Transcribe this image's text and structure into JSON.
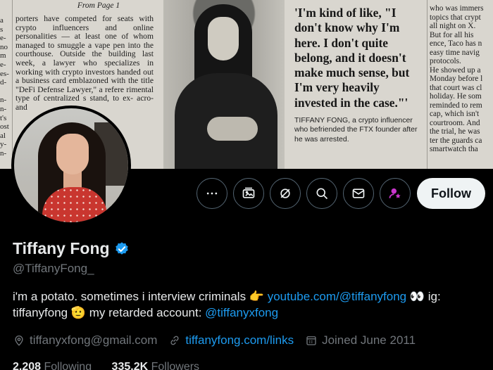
{
  "banner": {
    "left_edge_text": [
      "a",
      "s",
      "e-",
      "no",
      "m",
      "e-",
      "es-",
      "d-",
      "",
      "n-",
      "n-",
      "t's",
      "ost",
      "al",
      "y-",
      "n-"
    ],
    "kicker": "From Page 1",
    "article_text": "porters have competed for seats with crypto influencers and online personalities — at least one of whom managed to smuggle a vape pen into the courthouse. Outside the building last week, a lawyer who specializes in working with crypto investors handed out a business card emblazoned with the title \"DeFi Defense Lawyer,\" a refere rimental type of centralized s stand, to ex- acro- and",
    "quote": "'I'm kind of like, \"I don't know why I'm here. I don't quite belong, and it doesn't make much sense, but I'm very heavily invested in the case.\"'",
    "caption": "TIFFANY FONG, a crypto influencer who befriended the FTX founder after he was arrested.",
    "right_text": [
      "who was immers",
      "topics that crypt",
      "all night on X.",
      "But for all his",
      "ence, Taco has n",
      "easy time navig",
      "protocols.",
      "He showed up a",
      "Monday before l",
      "that court was cl",
      "holiday. He som",
      "reminded to rem",
      "cap, which isn't",
      "courtroom. And",
      "the trial, he was",
      "ter the guards ca",
      "smartwatch tha"
    ]
  },
  "actions": {
    "more_icon": "more-horizontal-icon",
    "media_icon": "photo-icon",
    "grok_icon": "grok-icon",
    "search_icon": "search-icon",
    "message_icon": "envelope-icon",
    "subscribe_icon": "subscribe-icon",
    "follow_label": "Follow"
  },
  "profile": {
    "display_name": "Tiffany Fong",
    "handle": "@TiffanyFong_",
    "bio_text_1": "i'm a potato. sometimes i interview criminals 👉 ",
    "bio_link_1": "youtube.com/@tiffanyfong",
    "bio_text_2": " 👀 ig: tiffanyfong 🫡 my retarded account: ",
    "bio_link_2": "@tiffanyxfong",
    "location": "tiffanyxfong@gmail.com",
    "website": "tiffanyfong.com/links",
    "joined": "Joined June 2011",
    "following_count": "2,208",
    "following_label": "Following",
    "followers_count": "335.2K",
    "followers_label": "Followers"
  },
  "colors": {
    "accent": "#1d9bf0",
    "subscribe": "#c936cc",
    "muted": "#71767b"
  }
}
